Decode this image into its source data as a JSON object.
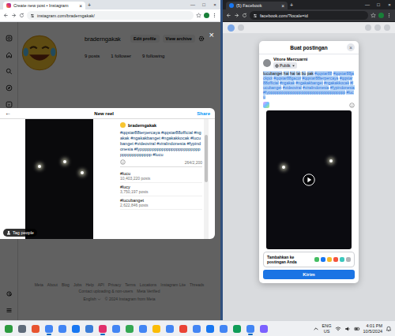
{
  "left_window": {
    "tab": {
      "title": "Create new post • Instagram",
      "close": "×"
    },
    "new_tab": "+",
    "controls": [
      "—",
      "□",
      "×"
    ],
    "address": "instagram.com/braderngakak/",
    "profile": {
      "username": "braderngakak",
      "buttons": [
        "Edit profile",
        "View archive"
      ],
      "stats": [
        "9 posts",
        "1 follower",
        "9 following"
      ]
    },
    "overlay_close": "×",
    "modal": {
      "back": "←",
      "title": "New reel",
      "action": "Share",
      "tag_people": "Tag people",
      "user": "braderngakak",
      "caption": "#qqstar88terpercaya #qqstar88official #ngakak #ngakakbanget #ngakakkocak #lucubanget #videoviral #viralindonesia #fypindonesia #fypppppppppppppppppppppppppppppppppppppp #lucu",
      "count": "264/2,200",
      "suggestions": [
        {
          "tag": "#lucu",
          "posts": "10,403,220 posts"
        },
        {
          "tag": "#lucy",
          "posts": "3,750,197 posts"
        },
        {
          "tag": "#lucubanget",
          "posts": "2,622,846 posts"
        }
      ]
    },
    "footer": {
      "links": [
        "Meta",
        "About",
        "Blog",
        "Jobs",
        "Help",
        "API",
        "Privacy",
        "Terms",
        "Locations",
        "Instagram Lite",
        "Threads",
        "Contact uploading & non-users",
        "Meta Verified"
      ],
      "language": "English",
      "copyright": "© 2024 Instagram from Meta"
    }
  },
  "right_window": {
    "tab": {
      "title": "(5) Facebook",
      "close": "×"
    },
    "new_tab": "+",
    "controls": [
      "—",
      "□",
      "×"
    ],
    "address": "facebook.com/?locale=id",
    "modal": {
      "title": "Buat postingan",
      "close": "×",
      "user": "Vitore Mercuarni",
      "audience": "Publik",
      "caption": "lucubanget hai hai lat bu pak #qqstar88 #qqstar88jackpot #qqstar88gacor #qqstar88terpercaya #qqstar88official #ngakak #ngakakbanget #ngakakkocak #lucubanget #videoviral #viralindonesia #fypindonesia #fyppppppppppppppppppppppppppppppppppp #lucu",
      "caption_selected": true,
      "add_label": "Tambahkan ke postingan Anda",
      "submit": "Kirim"
    }
  },
  "taskbar": {
    "apps": [
      {
        "color": "#2b9a3e",
        "running": false
      },
      {
        "color": "#5f6b7a",
        "running": false
      },
      {
        "color": "#e8542f",
        "running": false
      },
      {
        "color": "#4285f4",
        "running": true
      },
      {
        "color": "#4285f4",
        "running": false
      },
      {
        "color": "#1877f2",
        "running": false
      },
      {
        "color": "#3b7dd8",
        "running": false
      },
      {
        "color": "#e1306c",
        "running": true
      },
      {
        "color": "#4285f4",
        "running": false
      },
      {
        "color": "#34a853",
        "running": false
      },
      {
        "color": "#4285f4",
        "running": false
      },
      {
        "color": "#fbbc05",
        "running": false
      },
      {
        "color": "#4285f4",
        "running": false
      },
      {
        "color": "#ea4335",
        "running": false
      },
      {
        "color": "#4285f4",
        "running": false
      },
      {
        "color": "#1877f2",
        "running": false
      },
      {
        "color": "#4285f4",
        "running": false
      },
      {
        "color": "#0f9d58",
        "running": false
      },
      {
        "color": "#4285f4",
        "running": true
      },
      {
        "color": "#7b61ff",
        "running": false
      }
    ],
    "tray": {
      "language": "ENG",
      "region": "US",
      "time": "4:01 PM",
      "date": "10/5/2024"
    }
  }
}
